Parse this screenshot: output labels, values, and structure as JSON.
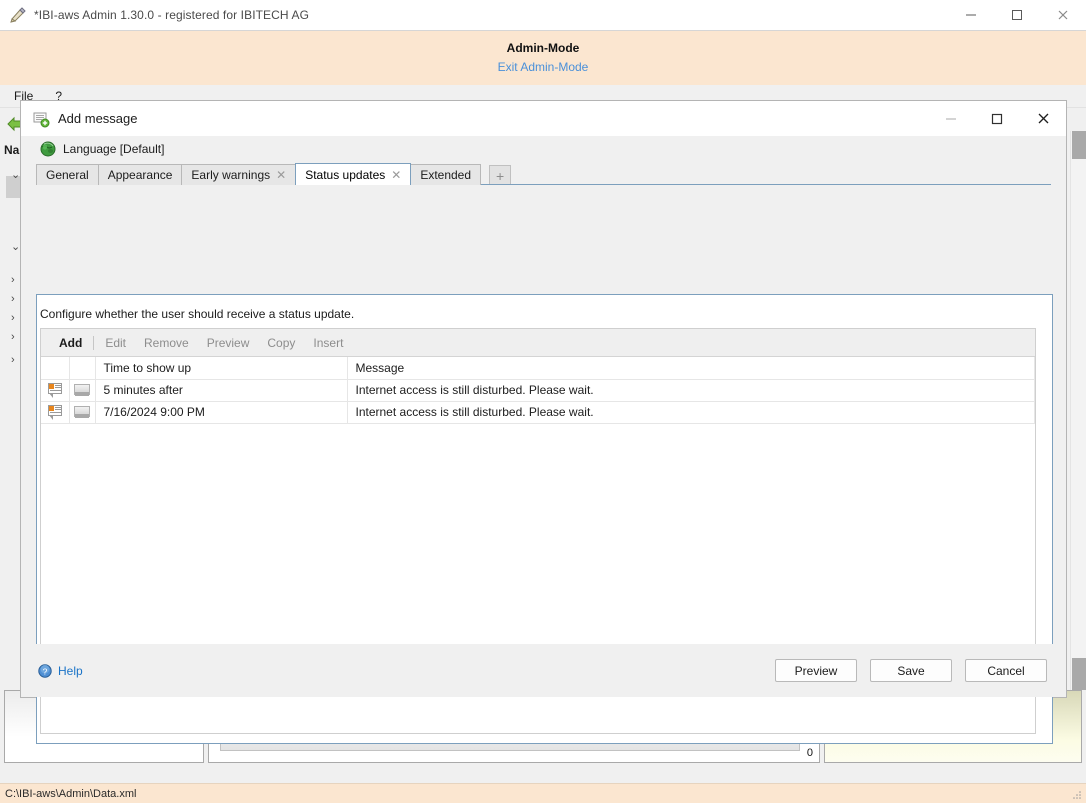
{
  "app": {
    "title": "*IBI-aws Admin 1.30.0 - registered for IBITECH AG",
    "icon": "app-logo-icon",
    "window_controls": {
      "minimize": "minimize-icon",
      "maximize": "maximize-icon",
      "close": "close-icon"
    },
    "admin_banner": {
      "title": "Admin-Mode",
      "link": "Exit Admin-Mode"
    },
    "menu": [
      "File",
      "?"
    ],
    "nav_title": "Na",
    "status_path": "C:\\IBI-aws\\Admin\\Data.xml",
    "bottom_panel_count": "0"
  },
  "dialog": {
    "title": "Add message",
    "icon": "add-message-icon",
    "window_controls": {
      "minimize": "minimize-icon",
      "maximize": "maximize-icon",
      "close": "close-icon"
    },
    "language": {
      "icon": "globe-icon",
      "label": "Language [Default]"
    },
    "tabs": [
      {
        "label": "General",
        "active": false,
        "closable": false
      },
      {
        "label": "Appearance",
        "active": false,
        "closable": false
      },
      {
        "label": "Early warnings",
        "active": false,
        "closable": true
      },
      {
        "label": "Status updates",
        "active": true,
        "closable": true
      },
      {
        "label": "Extended",
        "active": false,
        "closable": false
      }
    ],
    "tab_add_label": "+",
    "panel": {
      "description": "Configure whether the user should receive a status update.",
      "commands": [
        {
          "label": "Add",
          "enabled": true
        },
        {
          "label": "Edit",
          "enabled": false
        },
        {
          "label": "Remove",
          "enabled": false
        },
        {
          "label": "Preview",
          "enabled": false
        },
        {
          "label": "Copy",
          "enabled": false
        },
        {
          "label": "Insert",
          "enabled": false
        }
      ],
      "columns": [
        "",
        "",
        "Time to show up",
        "Message"
      ],
      "rows": [
        {
          "message_icon": "message-bubble-icon",
          "screen_icon": "screen-icon",
          "time": "5 minutes after",
          "message": "Internet access is still disturbed. Please wait."
        },
        {
          "message_icon": "message-bubble-icon",
          "screen_icon": "screen-icon",
          "time": "7/16/2024 9:00 PM",
          "message": "Internet access is still disturbed. Please wait."
        }
      ]
    },
    "footer": {
      "help": {
        "icon": "help-icon",
        "label": "Help"
      },
      "buttons": [
        {
          "label": "Preview"
        },
        {
          "label": "Save"
        },
        {
          "label": "Cancel"
        }
      ]
    }
  },
  "colors": {
    "admin_band": "#fbe6d0",
    "link": "#4a90d9",
    "accent_tab_border": "#7c9fbd",
    "icon_orange": "#e8861e",
    "help_link": "#1a73c7"
  }
}
